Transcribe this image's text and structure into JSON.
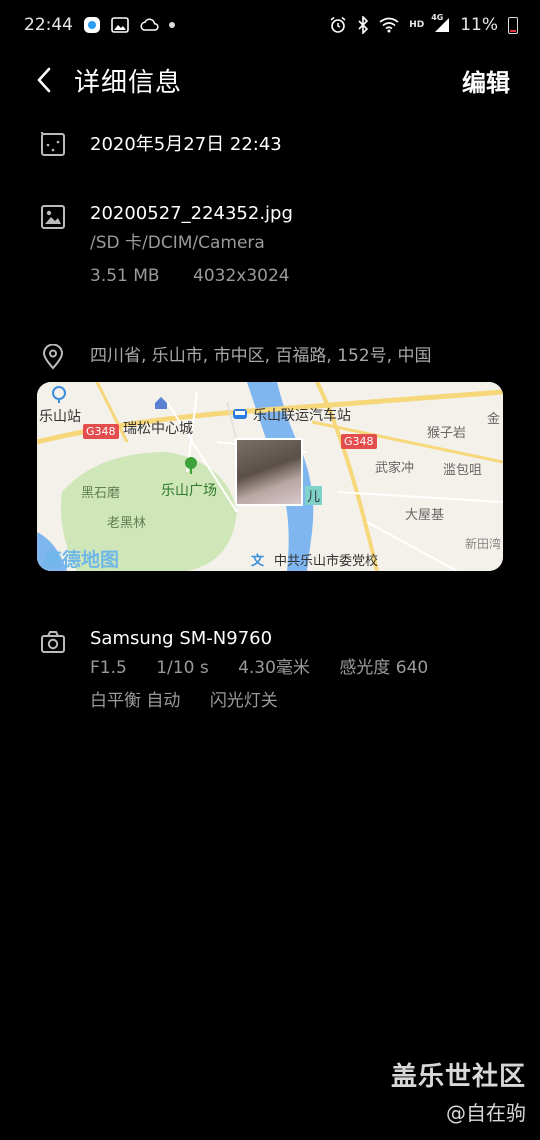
{
  "status_bar": {
    "time": "22:44",
    "battery_text": "11%",
    "network_label": "HD",
    "signal_label": "4G"
  },
  "header": {
    "title": "详细信息",
    "edit_label": "编辑"
  },
  "date_row": {
    "datetime": "2020年5月27日 22:43"
  },
  "file_row": {
    "filename": "20200527_224352.jpg",
    "path": "/SD 卡/DCIM/Camera",
    "size": "3.51 MB",
    "resolution": "4032x3024"
  },
  "location_row": {
    "address": "四川省, 乐山市, 市中区, 百福路, 152号, 中国"
  },
  "map": {
    "labels": {
      "leshan_station": "乐山站",
      "ruisong": "瑞松中心城",
      "bus_station": "乐山联运汽车站",
      "g348_left": "G348",
      "g348_right": "G348",
      "houzi": "猴子岩",
      "wujia": "武家冲",
      "zhanbao": "滥包咀",
      "heishi": "黑石磨",
      "laoheilin": "老黑林",
      "plaza": "乐山广场",
      "dawu": "大屋基",
      "xintian": "新田湾",
      "party_school": "中共乐山市委党校",
      "road_tag": "儿",
      "gold": "金",
      "amap_logo": "高德地图"
    }
  },
  "camera_row": {
    "model": "Samsung SM-N9760",
    "aperture": "F1.5",
    "shutter": "1/10 s",
    "focal": "4.30毫米",
    "iso": "感光度 640",
    "white_balance": "白平衡 自动",
    "flash": "闪光灯关"
  },
  "watermark": {
    "main": "盖乐世社区",
    "sub": "@自在驹"
  },
  "colors": {
    "background": "#000000",
    "secondary_text": "#9a9a9a",
    "map_water": "#7fb6f0",
    "map_green": "#cfe6b8",
    "road_yellow": "#f6d77a",
    "g_road_badge": "#e44d4d"
  }
}
